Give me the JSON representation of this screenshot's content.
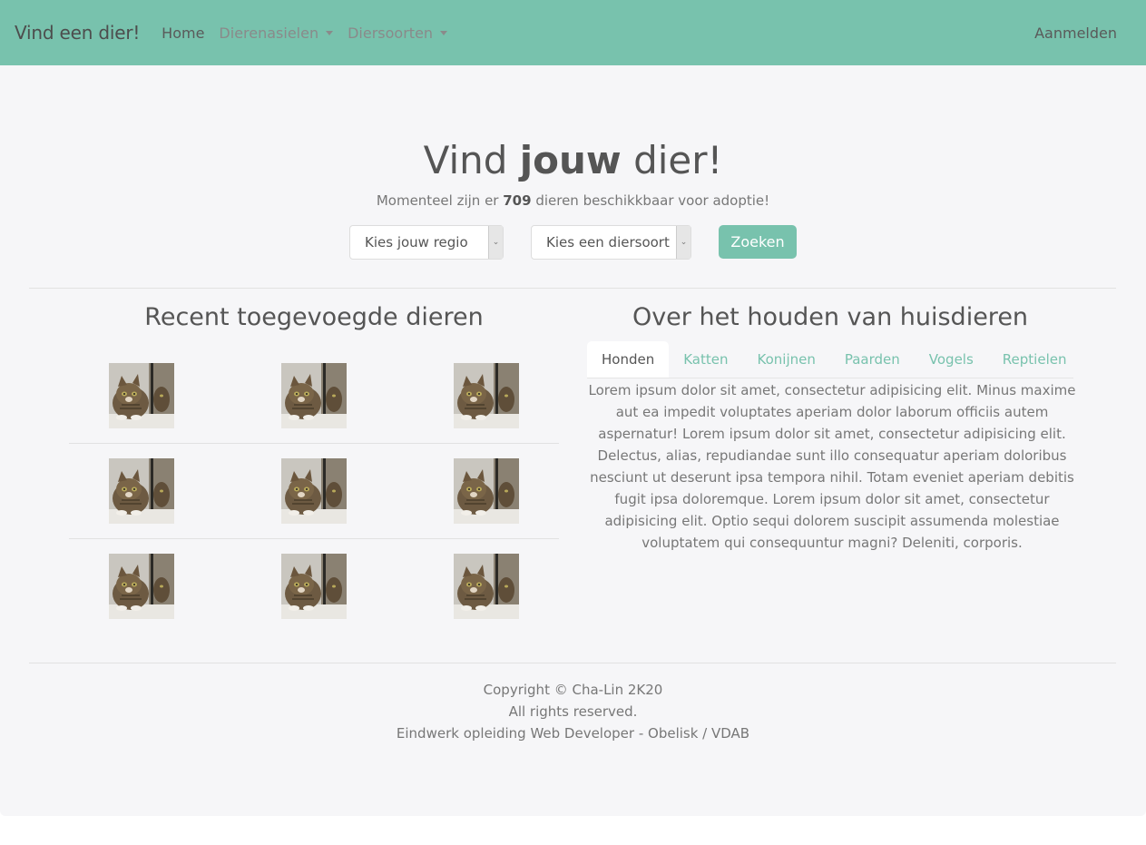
{
  "navbar": {
    "brand": "Vind een dier!",
    "home": "Home",
    "shelters": "Dierenasielen",
    "species": "Diersoorten",
    "login": "Aanmelden"
  },
  "hero": {
    "title_pre": "Vind ",
    "title_bold": "jouw",
    "title_post": " dier!",
    "sub_pre": "Momenteel zijn er ",
    "count": "709",
    "sub_post": " dieren beschikkbaar voor adoptie!",
    "region_select": "Kies jouw regio",
    "species_select": "Kies een diersoort",
    "search_button": "Zoeken"
  },
  "recent": {
    "title": "Recent toegevoegde dieren",
    "images": 9
  },
  "info": {
    "title": "Over het houden van huisdieren",
    "tabs": [
      "Honden",
      "Katten",
      "Konijnen",
      "Paarden",
      "Vogels",
      "Reptielen"
    ],
    "active_tab": "Honden",
    "text": "Lorem ipsum dolor sit amet, consectetur adipisicing elit. Minus maxime aut ea impedit voluptates aperiam dolor laborum officiis autem aspernatur! Lorem ipsum dolor sit amet, consectetur adipisicing elit. Delectus, alias, repudiandae sunt illo consequatur aperiam doloribus nesciunt ut deserunt ipsa tempora nihil. Totam eveniet aperiam debitis fugit ipsa doloremque. Lorem ipsum dolor sit amet, consectetur adipisicing elit. Optio sequi dolorem suscipit assumenda molestiae voluptatem qui consequuntur magni? Deleniti, corporis."
  },
  "footer": {
    "line1": "Copyright © Cha-Lin 2K20",
    "line2": "All rights reserved.",
    "line3": "Eindwerk opleiding Web Developer - Obelisk / VDAB"
  },
  "colors": {
    "accent": "#78c2ad",
    "background": "#f6f6f8"
  }
}
